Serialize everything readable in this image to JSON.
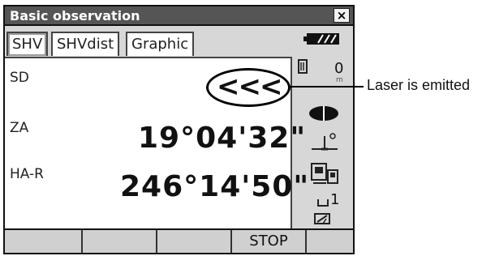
{
  "window": {
    "title": "Basic observation",
    "close_label": "×"
  },
  "tabs": [
    {
      "label": "SHV",
      "active": true
    },
    {
      "label": "SHVdist",
      "active": false
    },
    {
      "label": "Graphic",
      "active": false
    }
  ],
  "measurements": {
    "sd": {
      "label": "SD",
      "value": "<<<"
    },
    "za": {
      "label": "ZA",
      "value": "19°04'32\""
    },
    "har": {
      "label": "HA-R",
      "value": "246°14'50\""
    }
  },
  "status": {
    "battery_icon": "battery-icon",
    "signal_value": "0",
    "signal_unit": "m",
    "prism_icon": "target-icon",
    "tilt_icon": "tilt-icon",
    "mode_icon": "mode-icon",
    "page_number": "1",
    "input_icon": "input-mode-icon"
  },
  "softkeys": [
    "",
    "",
    "",
    "STOP",
    ""
  ],
  "annotation": {
    "text": "Laser is emitted"
  }
}
